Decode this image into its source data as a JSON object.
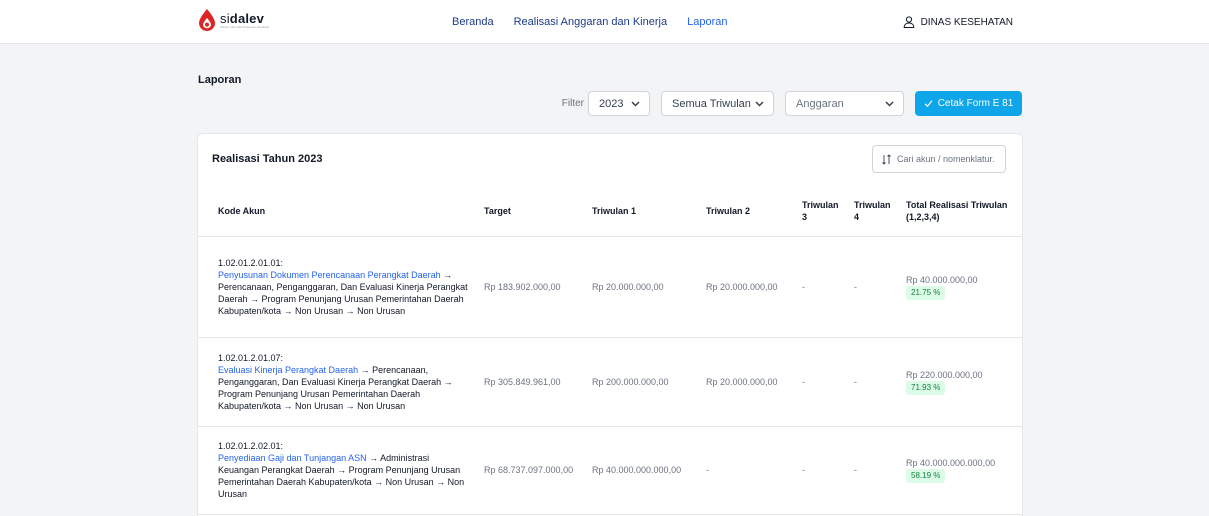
{
  "brand": {
    "name_light": "si",
    "name_bold": "dalev",
    "tagline": "Sistem Informasi Pelaporan Evaluasi"
  },
  "nav": {
    "items": [
      "Beranda",
      "Realisasi Anggaran dan Kinerja",
      "Laporan"
    ],
    "active": "Laporan"
  },
  "user": {
    "name": "DINAS KESEHATAN"
  },
  "page": {
    "title": "Laporan"
  },
  "filters": {
    "label": "Filter",
    "year": "2023",
    "triwulan": "Semua Triwulan",
    "anggaran_placeholder": "Anggaran",
    "print_button": "Cetak Form E 81"
  },
  "card": {
    "title": "Realisasi Tahun 2023",
    "search_placeholder": "Cari akun / nomenklatur."
  },
  "table": {
    "headers": [
      "Kode Akun",
      "Target",
      "Triwulan 1",
      "Triwulan 2",
      "Triwulan 3",
      "Triwulan 4",
      "Total Realisasi Triwulan (1,2,3,4)"
    ],
    "rows": [
      {
        "code": "1.02.01.2.01.01:",
        "link": "Penyusunan Dokumen Perencanaan Perangkat Daerah",
        "rest": " → Perencanaan, Penganggaran, Dan Evaluasi Kinerja Perangkat Daerah → Program Penunjang Urusan Pemerintahan Daerah Kabupaten/kota → Non Urusan → Non Urusan",
        "target": "Rp 183.902.000,00",
        "tw1": "Rp 20.000.000,00",
        "tw2": "Rp 20.000.000,00",
        "tw3": "-",
        "tw4": "-",
        "total": "Rp 40.000.000,00",
        "percent": "21.75 %"
      },
      {
        "code": "1.02.01.2.01.07:",
        "link": "Evaluasi Kinerja Perangkat Daerah",
        "rest": " → Perencanaan, Penganggaran, Dan Evaluasi Kinerja Perangkat Daerah → Program Penunjang Urusan Pemerintahan Daerah Kabupaten/kota → Non Urusan → Non Urusan",
        "target": "Rp 305.849.961,00",
        "tw1": "Rp 200.000.000,00",
        "tw2": "Rp 20.000.000,00",
        "tw3": "-",
        "tw4": "-",
        "total": "Rp 220.000.000,00",
        "percent": "71.93 %"
      },
      {
        "code": "1.02.01.2.02.01:",
        "link": "Penyediaan Gaji dan Tunjangan ASN",
        "rest": " → Administrasi Keuangan Perangkat Daerah → Program Penunjang Urusan Pemerintahan Daerah Kabupaten/kota → Non Urusan → Non Urusan",
        "target": "Rp 68.737.097.000,00",
        "tw1": "Rp 40.000.000.000,00",
        "tw2": "-",
        "tw3": "-",
        "tw4": "-",
        "total": "Rp 40.000.000.000,00",
        "percent": "58.19 %"
      }
    ]
  }
}
